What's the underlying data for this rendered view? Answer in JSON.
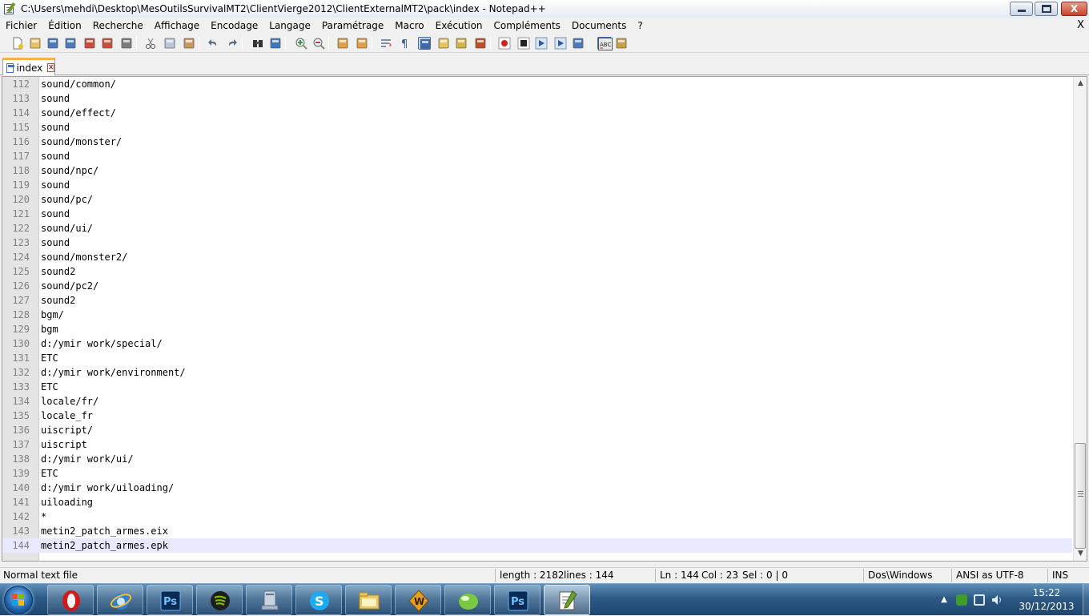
{
  "window": {
    "title": "C:\\Users\\mehdi\\Desktop\\MesOutilsSurvivalMT2\\ClientVierge2012\\ClientExternalMT2\\pack\\index - Notepad++",
    "minimize_icon": "minimize-icon",
    "maximize_icon": "maximize-icon",
    "close_label": "X"
  },
  "menu": {
    "items": [
      "Fichier",
      "Édition",
      "Recherche",
      "Affichage",
      "Encodage",
      "Langage",
      "Paramétrage",
      "Macro",
      "Exécution",
      "Compléments",
      "Documents",
      "?"
    ],
    "close_label": "X"
  },
  "toolbar": {
    "icons": [
      "new-file-icon",
      "open-file-icon",
      "save-icon",
      "save-all-icon",
      "close-icon",
      "close-all-icon",
      "print-icon",
      "cut-icon",
      "copy-icon",
      "paste-icon",
      "undo-icon",
      "redo-icon",
      "find-icon",
      "replace-icon",
      "zoom-in-icon",
      "zoom-out-icon",
      "sync-vertical-icon",
      "sync-horizontal-icon",
      "word-wrap-icon",
      "show-all-chars-icon",
      "indent-guide-icon",
      "user-lang-icon",
      "doc-map-icon",
      "function-list-icon",
      "record-macro-icon",
      "stop-record-icon",
      "play-macro-icon",
      "run-macro-multiple-icon",
      "save-macro-icon",
      "spell-check-icon",
      "spell-options-icon"
    ]
  },
  "tabs": [
    {
      "label": "index",
      "active": true
    }
  ],
  "editor": {
    "current_line": 144,
    "lines": [
      {
        "n": "112",
        "text": "sound/common/"
      },
      {
        "n": "113",
        "text": "sound"
      },
      {
        "n": "114",
        "text": "sound/effect/"
      },
      {
        "n": "115",
        "text": "sound"
      },
      {
        "n": "116",
        "text": "sound/monster/"
      },
      {
        "n": "117",
        "text": "sound"
      },
      {
        "n": "118",
        "text": "sound/npc/"
      },
      {
        "n": "119",
        "text": "sound"
      },
      {
        "n": "120",
        "text": "sound/pc/"
      },
      {
        "n": "121",
        "text": "sound"
      },
      {
        "n": "122",
        "text": "sound/ui/"
      },
      {
        "n": "123",
        "text": "sound"
      },
      {
        "n": "124",
        "text": "sound/monster2/"
      },
      {
        "n": "125",
        "text": "sound2"
      },
      {
        "n": "126",
        "text": "sound/pc2/"
      },
      {
        "n": "127",
        "text": "sound2"
      },
      {
        "n": "128",
        "text": "bgm/"
      },
      {
        "n": "129",
        "text": "bgm"
      },
      {
        "n": "130",
        "text": "d:/ymir work/special/"
      },
      {
        "n": "131",
        "text": "ETC"
      },
      {
        "n": "132",
        "text": "d:/ymir work/environment/"
      },
      {
        "n": "133",
        "text": "ETC"
      },
      {
        "n": "134",
        "text": "locale/fr/"
      },
      {
        "n": "135",
        "text": "locale_fr"
      },
      {
        "n": "136",
        "text": "uiscript/"
      },
      {
        "n": "137",
        "text": "uiscript"
      },
      {
        "n": "138",
        "text": "d:/ymir work/ui/"
      },
      {
        "n": "139",
        "text": "ETC"
      },
      {
        "n": "140",
        "text": "d:/ymir work/uiloading/"
      },
      {
        "n": "141",
        "text": "uiloading"
      },
      {
        "n": "142",
        "text": "*"
      },
      {
        "n": "143",
        "text": "metin2_patch_armes.eix"
      },
      {
        "n": "144",
        "text": "metin2_patch_armes.epk"
      }
    ],
    "scroll_position": 0.94
  },
  "status": {
    "file_type": "Normal text file",
    "length": "length : 2182",
    "lines": "lines : 144",
    "ln": "Ln : 144",
    "col": "Col : 23",
    "sel": "Sel : 0 | 0",
    "eol": "Dos\\Windows",
    "encoding": "ANSI as UTF-8",
    "mode": "INS"
  },
  "taskbar": {
    "apps": [
      "opera-icon",
      "internet-explorer-icon",
      "photoshop-icon",
      "spotify-icon",
      "computer-icon",
      "skype-icon",
      "file-explorer-icon",
      "winamp-icon",
      "game-icon",
      "photoshop-icon",
      "notepad-plus-plus-icon"
    ],
    "active_app": "notepad-plus-plus-icon",
    "clock_time": "15:22",
    "clock_date": "30/12/2013"
  }
}
